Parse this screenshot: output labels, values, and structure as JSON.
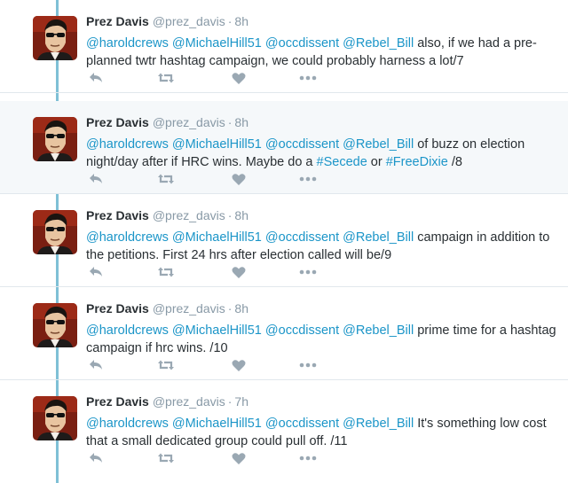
{
  "author": {
    "name": "Prez Davis",
    "handle": "@prez_davis",
    "avatar_icon": "portrait-sunglasses-icon"
  },
  "colors": {
    "link": "#1b95c8",
    "thread_line": "#7fc0d6",
    "muted": "#8899a6",
    "highlight_bg": "#f5f8fa"
  },
  "tweets": [
    {
      "time": "8h",
      "mentions": [
        "@haroldcrews",
        "@MichaelHill51",
        "@occdissent",
        "@Rebel_Bill"
      ],
      "line1": "also, if we had a pre-",
      "line2": "planned twtr hashtag campaign, we could probably harness a lot/7"
    },
    {
      "time": "8h",
      "mentions": [
        "@haroldcrews",
        "@MichaelHill51",
        "@occdissent",
        "@Rebel_Bill"
      ],
      "line1": "of buzz on election",
      "line2_pre": "night/day after if HRC wins. Maybe do a ",
      "hashtag1": "#Secede",
      "line2_mid": " or ",
      "hashtag2": "#FreeDixie",
      "line2_post": " /8"
    },
    {
      "time": "8h",
      "mentions": [
        "@haroldcrews",
        "@MichaelHill51",
        "@occdissent",
        "@Rebel_Bill"
      ],
      "line1": "campaign in addition to",
      "line2": "the petitions. First 24 hrs after election called will be/9"
    },
    {
      "time": "8h",
      "mentions": [
        "@haroldcrews",
        "@MichaelHill51",
        "@occdissent",
        "@Rebel_Bill"
      ],
      "line1": "prime time for a hashtag",
      "line2": "campaign if hrc wins. /10"
    },
    {
      "time": "7h",
      "mentions": [
        "@haroldcrews",
        "@MichaelHill51",
        "@occdissent",
        "@Rebel_Bill"
      ],
      "line1": "It's something low cost",
      "line2": "that a small dedicated group could pull off. /11"
    }
  ]
}
